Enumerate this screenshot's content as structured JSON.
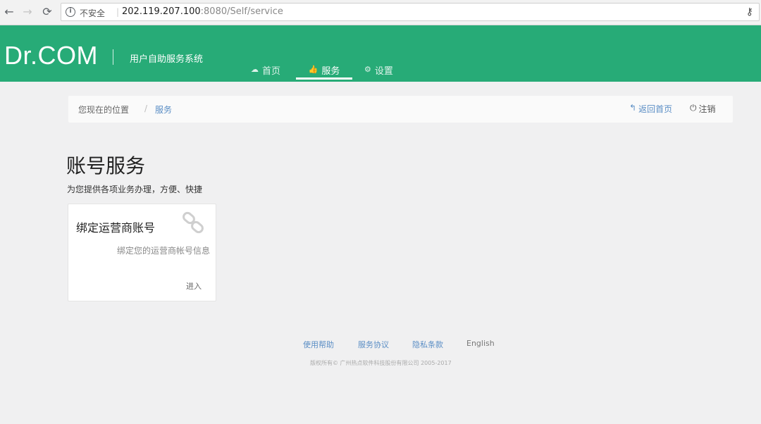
{
  "browser": {
    "back_icon": "←",
    "forward_icon": "→",
    "reload_icon": "⟳",
    "info_icon": "i",
    "security_label": "不安全",
    "url_host": "202.119.207.100",
    "url_rest": ":8080/Self/service",
    "key_icon": "⚷"
  },
  "header": {
    "logo": "Dr.COM",
    "subtitle": "用户自助服务系统",
    "brand_color": "#27ab77",
    "nav": [
      {
        "label": "首页",
        "icon": "☁"
      },
      {
        "label": "服务",
        "icon": "👍"
      },
      {
        "label": "设置",
        "icon": "⚙"
      }
    ]
  },
  "breadcrumb": {
    "label": "您现在的位置",
    "separator": "/",
    "current": "服务",
    "back_home": "返回首页",
    "back_icon": "↰",
    "logout": "注销",
    "logout_icon": "⏻"
  },
  "page": {
    "title": "账号服务",
    "subtitle": "为您提供各项业务办理，方便、快捷"
  },
  "card": {
    "title": "绑定运营商账号",
    "description": "绑定您的运营商帐号信息",
    "action": "进入",
    "icon": "link-icon"
  },
  "footer": {
    "links": [
      "使用帮助",
      "服务协议",
      "隐私条款",
      "English"
    ],
    "copyright": "版权所有© 广州热点软件科技股份有限公司 2005-2017"
  }
}
